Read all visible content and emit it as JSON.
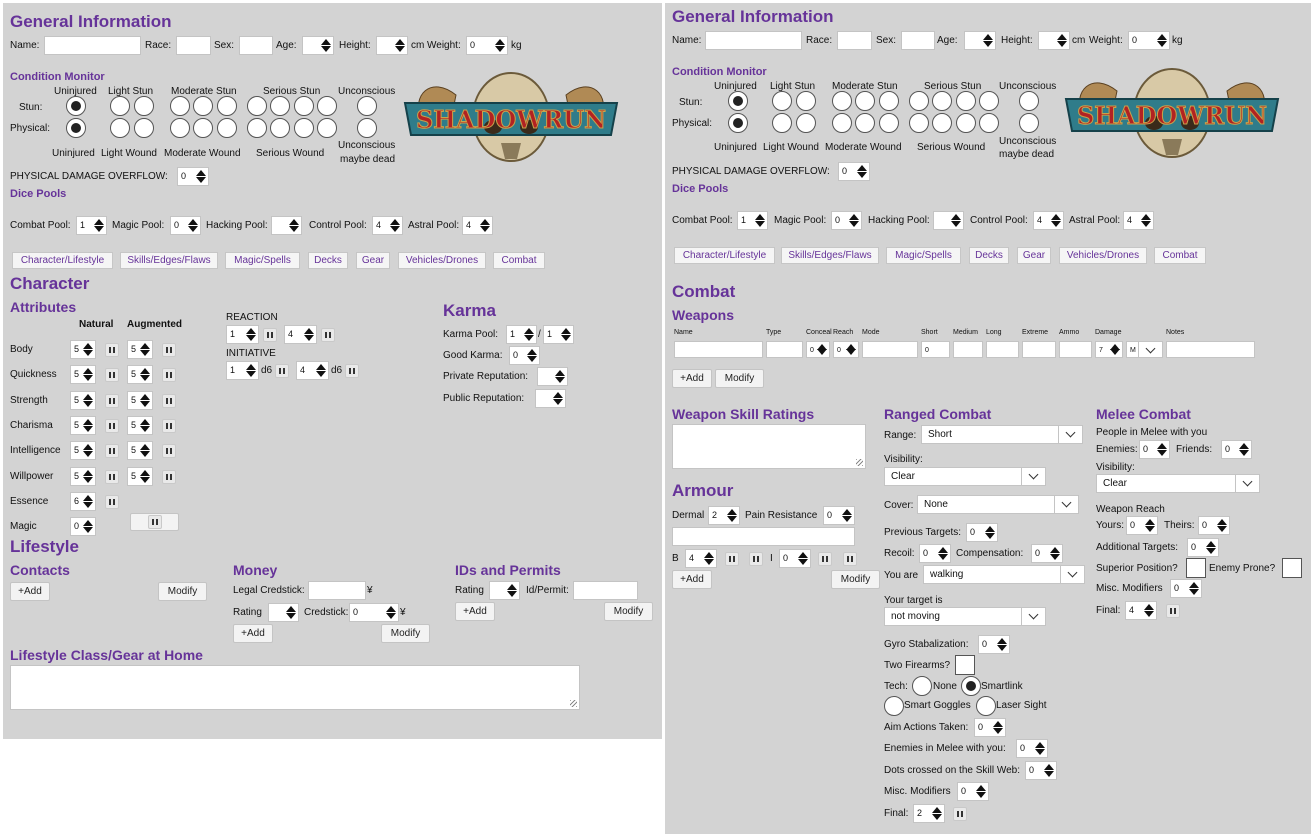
{
  "left": {
    "general": {
      "title": "General Information",
      "name_label": "Name:",
      "race_label": "Race:",
      "sex_label": "Sex:",
      "age_label": "Age:",
      "height_label": "Height:",
      "cm_label": "cm",
      "weight_label": "Weight:",
      "weight_value": "0",
      "kg_label": "kg"
    },
    "condition": {
      "title": "Condition Monitor",
      "col_uninjured": "Uninjured",
      "col_light": "Light Stun",
      "col_moderate": "Moderate Stun",
      "col_serious": "Serious Stun",
      "col_unconscious": "Unconscious",
      "row_stun": "Stun:",
      "row_physical": "Physical:",
      "foot_uninjured": "Uninjured",
      "foot_light": "Light Wound",
      "foot_moderate": "Moderate Wound",
      "foot_serious": "Serious Wound",
      "foot_unconscious_1": "Unconscious",
      "foot_unconscious_2": "maybe dead",
      "overflow_label": "PHYSICAL DAMAGE OVERFLOW:",
      "overflow_value": "0"
    },
    "logo_text": "SHADOWRUN",
    "dice": {
      "title": "Dice Pools",
      "combat_label": "Combat Pool:",
      "combat_value": "1",
      "magic_label": "Magic Pool:",
      "magic_value": "0",
      "hacking_label": "Hacking Pool:",
      "hacking_value": "",
      "control_label": "Control Pool:",
      "control_value": "4",
      "astral_label": "Astral Pool:",
      "astral_value": "4"
    },
    "tabs": [
      "Character/Lifestyle",
      "Skills/Edges/Flaws",
      "Magic/Spells",
      "Decks",
      "Gear",
      "Vehicles/Drones",
      "Combat"
    ],
    "character": {
      "title": "Character",
      "attributes_title": "Attributes",
      "natural_label": "Natural",
      "augmented_label": "Augmented",
      "attributes": [
        {
          "name": "Body",
          "natural": "5",
          "augmented": "5"
        },
        {
          "name": "Quickness",
          "natural": "5",
          "augmented": "5"
        },
        {
          "name": "Strength",
          "natural": "5",
          "augmented": "5"
        },
        {
          "name": "Charisma",
          "natural": "5",
          "augmented": "5"
        },
        {
          "name": "Intelligence",
          "natural": "5",
          "augmented": "5"
        },
        {
          "name": "Willpower",
          "natural": "5",
          "augmented": "5"
        },
        {
          "name": "Essence",
          "natural": "6",
          "augmented": ""
        },
        {
          "name": "Magic",
          "natural": "0",
          "augmented": ""
        }
      ],
      "reaction_label": "REACTION",
      "reaction_value1": "1",
      "reaction_value2": "4",
      "initiative_label": "INITIATIVE",
      "initiative_value1": "1",
      "initiative_value2": "4",
      "d6_label": "d6"
    },
    "karma": {
      "title": "Karma",
      "pool_label": "Karma Pool:",
      "pool_value1": "1",
      "pool_sep": "/",
      "pool_value2": "1",
      "good_label": "Good Karma:",
      "good_value": "0",
      "private_label": "Private Reputation:",
      "public_label": "Public Reputation:"
    },
    "lifestyle": {
      "title": "Lifestyle",
      "contacts_title": "Contacts",
      "add_label": "+Add",
      "modify_label": "Modify",
      "money_title": "Money",
      "legal_label": "Legal Credstick:",
      "yen": "¥",
      "rating_label": "Rating",
      "credstick_label": "Credstick:",
      "credstick_value": "0",
      "ids_title": "IDs and Permits",
      "id_rating_label": "Rating",
      "id_permit_label": "Id/Permit:",
      "class_title": "Lifestyle Class/Gear at Home"
    }
  },
  "right": {
    "general": {
      "title": "General Information",
      "name_label": "Name:",
      "race_label": "Race:",
      "sex_label": "Sex:",
      "age_label": "Age:",
      "height_label": "Height:",
      "cm_label": "cm",
      "weight_label": "Weight:",
      "weight_value": "0",
      "kg_label": "kg"
    },
    "condition": {
      "title": "Condition Monitor",
      "col_uninjured": "Uninjured",
      "col_light": "Light Stun",
      "col_moderate": "Moderate Stun",
      "col_serious": "Serious Stun",
      "col_unconscious": "Unconscious",
      "row_stun": "Stun:",
      "row_physical": "Physical:",
      "foot_uninjured": "Uninjured",
      "foot_light": "Light Wound",
      "foot_moderate": "Moderate Wound",
      "foot_serious": "Serious Wound",
      "foot_unconscious_1": "Unconscious",
      "foot_unconscious_2": "maybe dead",
      "overflow_label": "PHYSICAL DAMAGE OVERFLOW:",
      "overflow_value": "0"
    },
    "logo_text": "SHADOWRUN",
    "dice": {
      "title": "Dice Pools",
      "combat_label": "Combat Pool:",
      "combat_value": "1",
      "magic_label": "Magic Pool:",
      "magic_value": "0",
      "hacking_label": "Hacking Pool:",
      "hacking_value": "",
      "control_label": "Control Pool:",
      "control_value": "4",
      "astral_label": "Astral Pool:",
      "astral_value": "4"
    },
    "tabs": [
      "Character/Lifestyle",
      "Skills/Edges/Flaws",
      "Magic/Spells",
      "Decks",
      "Gear",
      "Vehicles/Drones",
      "Combat"
    ],
    "combat": {
      "title": "Combat",
      "weapons_title": "Weapons",
      "col_name": "Name",
      "col_type": "Type",
      "col_conceal": "Conceal",
      "col_reach": "Reach",
      "col_mode": "Mode",
      "col_short": "Short",
      "col_medium": "Medium",
      "col_long": "Long",
      "col_extreme": "Extreme",
      "col_ammo": "Ammo",
      "col_damage": "Damage",
      "col_notes": "Notes",
      "conceal_value": "0",
      "reach_value": "0",
      "short_value": "0",
      "damage_value": "7",
      "damage_code": "M",
      "add_label": "+Add",
      "modify_label": "Modify",
      "skill_title": "Weapon Skill Ratings",
      "armour_title": "Armour",
      "dermal_label": "Dermal",
      "dermal_value": "2",
      "pain_label": "Pain Resistance",
      "pain_value": "0",
      "b_label": "B",
      "b_value": "4",
      "i_label": "I",
      "i_value": "0",
      "ranged_title": "Ranged Combat",
      "range_label": "Range:",
      "range_value": "Short",
      "visibility_label": "Visibility:",
      "visibility_value": "Clear",
      "cover_label": "Cover:",
      "cover_value": "None",
      "prev_targets_label": "Previous Targets:",
      "prev_targets_value": "0",
      "recoil_label": "Recoil:",
      "recoil_value": "0",
      "compensation_label": "Compensation:",
      "compensation_value": "0",
      "you_are_label": "You are",
      "you_are_value": "walking",
      "target_label": "Your target is",
      "target_value": "not moving",
      "gyro_label": "Gyro Stabalization:",
      "gyro_value": "0",
      "two_firearms_label": "Two Firearms?",
      "tech_label": "Tech:",
      "tech_none": "None",
      "tech_smartlink": "Smartlink",
      "tech_goggles": "Smart Goggles",
      "tech_laser": "Laser Sight",
      "aim_label": "Aim Actions Taken:",
      "aim_value": "0",
      "enemies_melee_label": "Enemies in Melee with you:",
      "enemies_melee_value": "0",
      "dots_label": "Dots crossed on the Skill Web:",
      "dots_value": "0",
      "misc_label": "Misc. Modifiers",
      "misc_value": "0",
      "final_label": "Final:",
      "final_value": "2",
      "melee_title": "Melee Combat",
      "melee_people_label": "People in Melee with you",
      "enemies_label": "Enemies:",
      "enemies_value": "0",
      "friends_label": "Friends:",
      "friends_value": "0",
      "melee_visibility_label": "Visibility:",
      "melee_visibility_value": "Clear",
      "reach_title": "Weapon Reach",
      "yours_label": "Yours:",
      "yours_value": "0",
      "theirs_label": "Theirs:",
      "theirs_value": "0",
      "additional_label": "Additional Targets:",
      "additional_value": "0",
      "superior_label": "Superior Position?",
      "prone_label": "Enemy Prone?",
      "melee_misc_label": "Misc. Modifiers",
      "melee_misc_value": "0",
      "melee_final_label": "Final:",
      "melee_final_value": "4"
    }
  },
  "colors": {
    "accent": "#663399",
    "panel": "#d3d3d3",
    "logo_red": "#b22222",
    "logo_gold": "#c8a24a"
  }
}
